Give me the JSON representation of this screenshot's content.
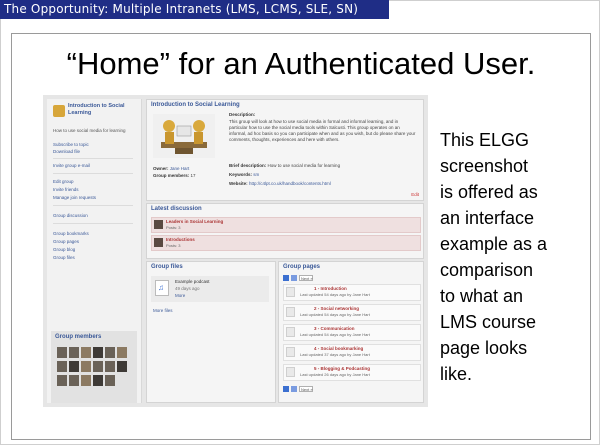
{
  "slide": {
    "section_title": "The Opportunity: Multiple Intranets (LMS, LCMS, SLE, SN)",
    "heading": "“Home” for an Authenticated User.",
    "caption_lines": [
      "This ELGG",
      "screenshot",
      "is offered as",
      "an interface",
      "example as a",
      "comparison",
      "to what an",
      "LMS course",
      "page looks",
      "like."
    ]
  },
  "shot": {
    "sidebar": {
      "group_title": "Introduction to Social Learning",
      "description": "How to use social media for learning",
      "links": [
        "Subscribe to topic",
        "Download file",
        "Invite group e-mail",
        "Edit group",
        "Invite friends",
        "Manage join requests",
        "Group discussion",
        "Group bookmarks",
        "Group pages",
        "Group blog",
        "Group files"
      ],
      "members_title": "Group members"
    },
    "main": {
      "group_title": "Introduction to Social Learning",
      "description_label": "Description:",
      "description_text": "This group will look at how to use social media in formal and informal learning, and in particular how to use the social media tools within Salcusti. This group operates on an informal, ad hoc basis so you can participate when and as you wish, but do please share your comments, thoughts, experiences and here with others.",
      "owner_label": "Owner:",
      "owner_value": "Jane Hart",
      "members_label": "Group members:",
      "members_value": "17",
      "brief_label": "Brief description:",
      "brief_value": "How to use social media for learning",
      "keywords_label": "Keywords:",
      "keywords_value": "sm",
      "website_label": "Website:",
      "website_value": "http://c4lpt.co.uk/handbook/contents.html",
      "edit": "Edit",
      "latest_title": "Latest discussion",
      "discussions": [
        {
          "title": "Leaders in Social Learning",
          "meta": "Posts: 3"
        },
        {
          "title": "Introductions",
          "meta": "Posts: 3"
        }
      ],
      "files_title": "Group files",
      "file_name": "Example podcast",
      "file_meta": "49 days ago",
      "file_more": "More",
      "more_files": "More files",
      "pages_title": "Group pages",
      "pages": [
        {
          "title": "1 - Introduction",
          "meta": "Last updated 54 days ago by Jane Hart"
        },
        {
          "title": "2 - Social networking",
          "meta": "Last updated 54 days ago by Jane Hart"
        },
        {
          "title": "3 - Communication",
          "meta": "Last updated 54 days ago by Jane Hart"
        },
        {
          "title": "4 - Social bookmarking",
          "meta": "Last updated 37 days ago by Jane Hart"
        },
        {
          "title": "5 - Blogging & Podcasting",
          "meta": "Last updated 26 days ago by Jane Hart"
        }
      ],
      "next": "Next »"
    }
  }
}
